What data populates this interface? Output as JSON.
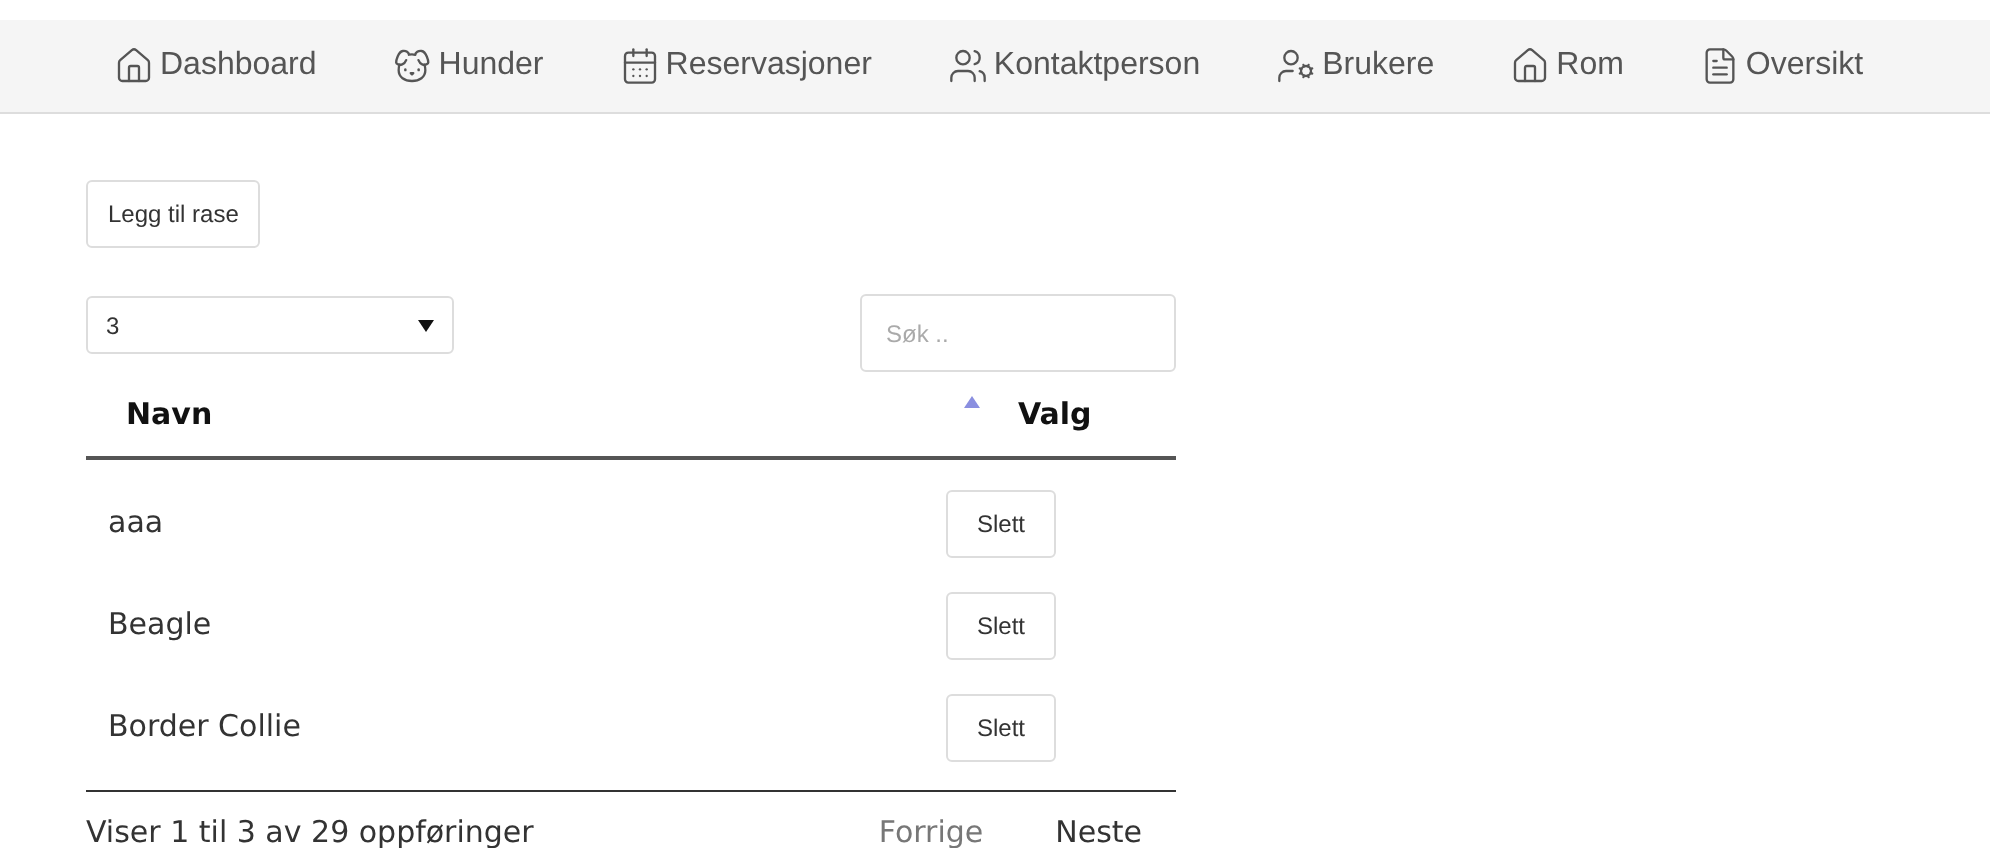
{
  "nav": [
    {
      "label": "Dashboard"
    },
    {
      "label": "Hunder"
    },
    {
      "label": "Reservasjoner"
    },
    {
      "label": "Kontaktperson"
    },
    {
      "label": "Brukere"
    },
    {
      "label": "Rom"
    },
    {
      "label": "Oversikt"
    }
  ],
  "add_button": "Legg til rase",
  "page_size": {
    "value": "3"
  },
  "search": {
    "placeholder": "Søk .."
  },
  "table": {
    "columns": [
      {
        "label": "Navn",
        "sorted_ascending": true
      },
      {
        "label": "Valg"
      }
    ],
    "rows": [
      {
        "name": "aaa",
        "action": "Slett"
      },
      {
        "name": "Beagle",
        "action": "Slett"
      },
      {
        "name": "Border Collie",
        "action": "Slett"
      }
    ]
  },
  "info": "Viser 1 til 3 av 29 oppføringer",
  "pagination": [
    {
      "label": "Forrige",
      "disabled": true
    },
    {
      "label": "Neste",
      "disabled": false
    }
  ]
}
